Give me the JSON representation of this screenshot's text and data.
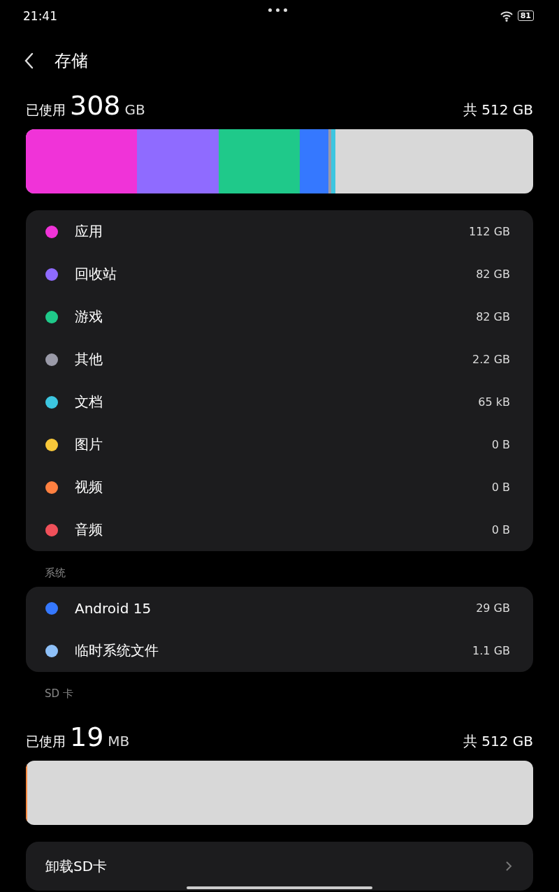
{
  "status_bar": {
    "time": "21:41",
    "battery": "81"
  },
  "header": {
    "title": "存储"
  },
  "internal": {
    "used_label": "已使用",
    "used_value": "308",
    "used_unit": "GB",
    "total": "共 512 GB",
    "segments": [
      {
        "color": "#f033d8"
      },
      {
        "color": "#8f6bff"
      },
      {
        "color": "#1fc98a"
      },
      {
        "color": "#3578ff"
      },
      {
        "color": "#9a9aa8"
      },
      {
        "color": "#3cc6e0"
      }
    ]
  },
  "categories": [
    {
      "name": "应用",
      "size": "112 GB",
      "color": "#f033d8"
    },
    {
      "name": "回收站",
      "size": "82 GB",
      "color": "#8f6bff"
    },
    {
      "name": "游戏",
      "size": "82 GB",
      "color": "#1fc98a"
    },
    {
      "name": "其他",
      "size": "2.2 GB",
      "color": "#9a9aa8"
    },
    {
      "name": "文档",
      "size": "65 kB",
      "color": "#3cc6e0"
    },
    {
      "name": "图片",
      "size": "0 B",
      "color": "#f8c83a"
    },
    {
      "name": "视频",
      "size": "0 B",
      "color": "#ff8040"
    },
    {
      "name": "音频",
      "size": "0 B",
      "color": "#f0505a"
    }
  ],
  "system": {
    "heading": "系统",
    "items": [
      {
        "name": "Android 15",
        "size": "29 GB",
        "color": "#3578ff"
      },
      {
        "name": "临时系统文件",
        "size": "1.1 GB",
        "color": "#8ec0f8"
      }
    ]
  },
  "sd_card": {
    "heading": "SD 卡",
    "used_label": "已使用",
    "used_value": "19",
    "used_unit": "MB",
    "total": "共 512 GB",
    "segments": [
      {
        "color": "#ff8a40"
      }
    ],
    "action": "卸载SD卡"
  }
}
